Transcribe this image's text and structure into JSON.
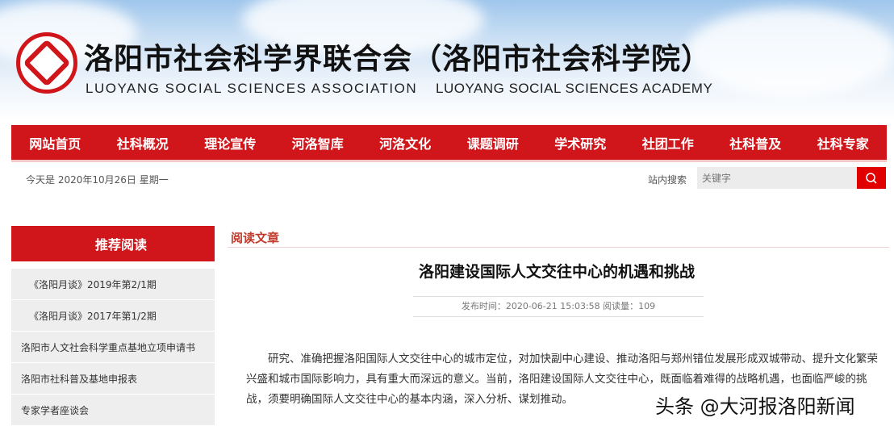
{
  "header": {
    "title_cn": "洛阳市社会科学界联合会（洛阳市社会科学院）",
    "title_en_1": "LUOYANG SOCIAL SCIENCES ASSOCIATION",
    "title_en_2": "LUOYANG SOCIAL SCIENCES ACADEMY"
  },
  "nav": [
    "网站首页",
    "社科概况",
    "理论宣传",
    "河洛智库",
    "河洛文化",
    "课题调研",
    "学术研究",
    "社团工作",
    "社科普及",
    "社科专家"
  ],
  "topbar": {
    "date": "今天是 2020年10月26日  星期一",
    "search_label": "站内搜索",
    "search_placeholder": "关键字"
  },
  "sidebar": {
    "title": "推荐阅读",
    "items": [
      "《洛阳月谈》2019年第2/1期",
      "《洛阳月谈》2017年第1/2期",
      "洛阳市人文社会科学重点基地立项申请书",
      "洛阳市社科普及基地申报表",
      "专家学者座谈会"
    ]
  },
  "article": {
    "section": "阅读文章",
    "title": "洛阳建设国际人文交往中心的机遇和挑战",
    "meta": "发布时间：2020-06-21 15:03:58    阅读量：109",
    "body": "研究、准确把握洛阳国际人文交往中心的城市定位，对加快副中心建设、推动洛阳与郑州错位发展形成双城带动、提升文化繁荣兴盛和城市国际影响力，具有重大而深远的意义。当前，洛阳建设国际人文交往中心，既面临着难得的战略机遇，也面临严峻的挑战，须要明确国际人文交往中心的基本内涵，深入分析、谋划推动。"
  },
  "watermark": "头条 @大河报洛阳新闻"
}
